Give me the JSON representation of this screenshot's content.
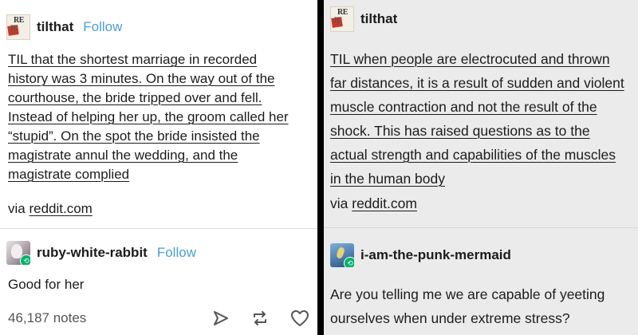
{
  "left_post": {
    "author": {
      "username": "tilthat",
      "follow_label": "Follow",
      "avatar_icon": "til-logo-icon"
    },
    "body_lines": [
      "TIL that the shortest marriage in recorded",
      "history was 3 minutes. On the way out of the",
      "courthouse, the bride tripped over and fell.",
      "Instead of helping her up, the groom called her",
      "“stupid”. On the spot the bride insisted the",
      "magistrate annul the wedding, and the",
      "magistrate complied"
    ],
    "via_prefix": "via",
    "via_link": "reddit.com",
    "reblog": {
      "username": "ruby-white-rabbit",
      "follow_label": "Follow",
      "comment": "Good for her"
    },
    "notes": "46,187 notes"
  },
  "right_post": {
    "author": {
      "username": "tilthat",
      "avatar_icon": "til-logo-icon"
    },
    "body_lines": [
      "TIL when people are electrocuted and thrown",
      "far distances, it is a result of sudden and violent",
      "muscle contraction and not the result of the",
      "shock. This has raised questions as to the",
      "actual strength and capabilities of the muscles",
      "in the human body"
    ],
    "via_prefix": "via",
    "via_link": "reddit.com",
    "reblog": {
      "username": "i-am-the-punk-mermaid",
      "comment_lines": [
        "Are you telling me we are capable of yeeting",
        "ourselves when under extreme stress?"
      ]
    }
  },
  "colors": {
    "follow": "#4a9fd6",
    "reblog_badge": "#00b36b",
    "text": "#1c1c1c"
  }
}
